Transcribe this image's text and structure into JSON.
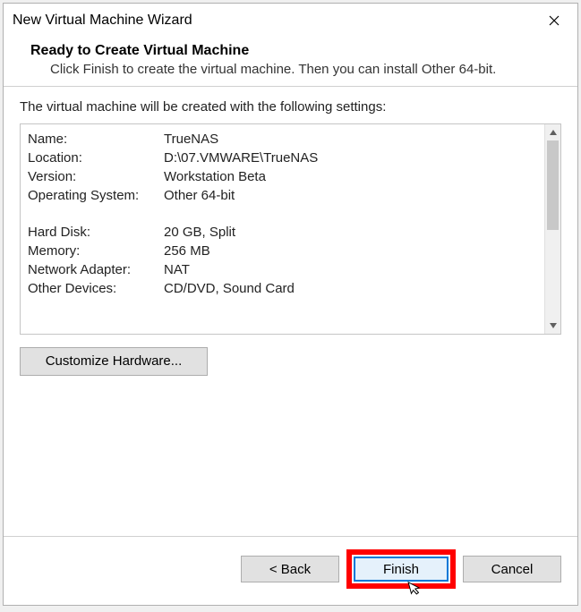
{
  "titlebar": {
    "title": "New Virtual Machine Wizard"
  },
  "header": {
    "heading": "Ready to Create Virtual Machine",
    "subtext": "Click Finish to create the virtual machine. Then you can install Other 64-bit."
  },
  "body": {
    "intro": "The virtual machine will be created with the following settings:",
    "settings": [
      {
        "label": "Name:",
        "value": "TrueNAS"
      },
      {
        "label": "Location:",
        "value": "D:\\07.VMWARE\\TrueNAS"
      },
      {
        "label": "Version:",
        "value": "Workstation Beta"
      },
      {
        "label": "Operating System:",
        "value": "Other 64-bit"
      }
    ],
    "settings2": [
      {
        "label": "Hard Disk:",
        "value": "20 GB, Split"
      },
      {
        "label": "Memory:",
        "value": "256 MB"
      },
      {
        "label": "Network Adapter:",
        "value": "NAT"
      },
      {
        "label": "Other Devices:",
        "value": "CD/DVD, Sound Card"
      }
    ],
    "customize_label": "Customize Hardware..."
  },
  "footer": {
    "back_label": "< Back",
    "finish_label": "Finish",
    "cancel_label": "Cancel"
  }
}
